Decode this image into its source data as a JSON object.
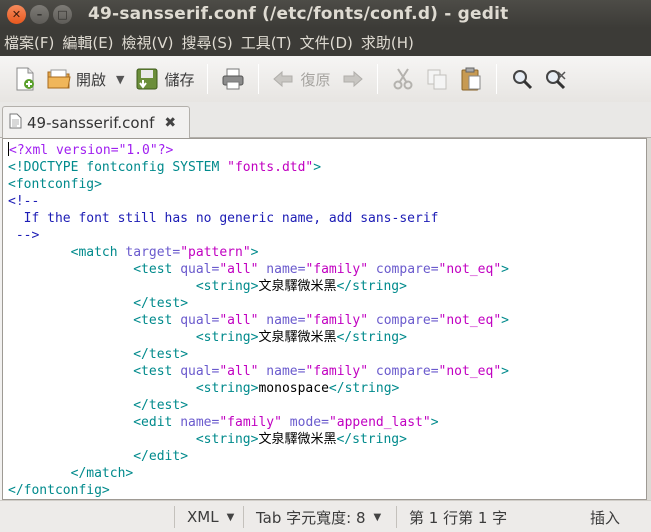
{
  "window": {
    "title": "49-sansserif.conf (/etc/fonts/conf.d) - gedit",
    "close_glyph": "✕",
    "min_glyph": "–",
    "max_glyph": "□"
  },
  "menu": [
    "檔案(F)",
    "編輯(E)",
    "檢視(V)",
    "搜尋(S)",
    "工具(T)",
    "文件(D)",
    "求助(H)"
  ],
  "toolbar": {
    "open_label": "開啟",
    "save_label": "儲存",
    "undo_label": "復原",
    "dropdown_glyph": "▼"
  },
  "tab": {
    "label": "49-sansserif.conf",
    "close_glyph": "✖"
  },
  "editor": {
    "lines": [
      [
        {
          "c": "pi",
          "t": "<?xml version=\"1.0\"?>"
        }
      ],
      [
        {
          "c": "tag",
          "t": "<!DOCTYPE fontconfig SYSTEM "
        },
        {
          "c": "str",
          "t": "\"fonts.dtd\""
        },
        {
          "c": "tag",
          "t": ">"
        }
      ],
      [
        {
          "c": "tag",
          "t": "<fontconfig>"
        }
      ],
      [
        {
          "c": "cmt",
          "t": "<!--"
        }
      ],
      [
        {
          "c": "cmt",
          "t": "  If the font still has no generic name, add sans-serif"
        }
      ],
      [
        {
          "c": "cmt",
          "t": " -->"
        }
      ],
      [
        {
          "c": "txt",
          "t": "        "
        },
        {
          "c": "tag",
          "t": "<match "
        },
        {
          "c": "attr",
          "t": "target="
        },
        {
          "c": "str",
          "t": "\"pattern\""
        },
        {
          "c": "tag",
          "t": ">"
        }
      ],
      [
        {
          "c": "txt",
          "t": "                "
        },
        {
          "c": "tag",
          "t": "<test "
        },
        {
          "c": "attr",
          "t": "qual="
        },
        {
          "c": "str",
          "t": "\"all\""
        },
        {
          "c": "attr",
          "t": " name="
        },
        {
          "c": "str",
          "t": "\"family\""
        },
        {
          "c": "attr",
          "t": " compare="
        },
        {
          "c": "str",
          "t": "\"not_eq\""
        },
        {
          "c": "tag",
          "t": ">"
        }
      ],
      [
        {
          "c": "txt",
          "t": "                        "
        },
        {
          "c": "tag",
          "t": "<string>"
        },
        {
          "c": "txt",
          "t": "文泉驛微米黑"
        },
        {
          "c": "tag",
          "t": "</string>"
        }
      ],
      [
        {
          "c": "txt",
          "t": "                "
        },
        {
          "c": "tag",
          "t": "</test>"
        }
      ],
      [
        {
          "c": "txt",
          "t": "                "
        },
        {
          "c": "tag",
          "t": "<test "
        },
        {
          "c": "attr",
          "t": "qual="
        },
        {
          "c": "str",
          "t": "\"all\""
        },
        {
          "c": "attr",
          "t": " name="
        },
        {
          "c": "str",
          "t": "\"family\""
        },
        {
          "c": "attr",
          "t": " compare="
        },
        {
          "c": "str",
          "t": "\"not_eq\""
        },
        {
          "c": "tag",
          "t": ">"
        }
      ],
      [
        {
          "c": "txt",
          "t": "                        "
        },
        {
          "c": "tag",
          "t": "<string>"
        },
        {
          "c": "txt",
          "t": "文泉驛微米黑"
        },
        {
          "c": "tag",
          "t": "</string>"
        }
      ],
      [
        {
          "c": "txt",
          "t": "                "
        },
        {
          "c": "tag",
          "t": "</test>"
        }
      ],
      [
        {
          "c": "txt",
          "t": "                "
        },
        {
          "c": "tag",
          "t": "<test "
        },
        {
          "c": "attr",
          "t": "qual="
        },
        {
          "c": "str",
          "t": "\"all\""
        },
        {
          "c": "attr",
          "t": " name="
        },
        {
          "c": "str",
          "t": "\"family\""
        },
        {
          "c": "attr",
          "t": " compare="
        },
        {
          "c": "str",
          "t": "\"not_eq\""
        },
        {
          "c": "tag",
          "t": ">"
        }
      ],
      [
        {
          "c": "txt",
          "t": "                        "
        },
        {
          "c": "tag",
          "t": "<string>"
        },
        {
          "c": "txt",
          "t": "monospace"
        },
        {
          "c": "tag",
          "t": "</string>"
        }
      ],
      [
        {
          "c": "txt",
          "t": "                "
        },
        {
          "c": "tag",
          "t": "</test>"
        }
      ],
      [
        {
          "c": "txt",
          "t": "                "
        },
        {
          "c": "tag",
          "t": "<edit "
        },
        {
          "c": "attr",
          "t": "name="
        },
        {
          "c": "str",
          "t": "\"family\""
        },
        {
          "c": "attr",
          "t": " mode="
        },
        {
          "c": "str",
          "t": "\"append_last\""
        },
        {
          "c": "tag",
          "t": ">"
        }
      ],
      [
        {
          "c": "txt",
          "t": "                        "
        },
        {
          "c": "tag",
          "t": "<string>"
        },
        {
          "c": "txt",
          "t": "文泉驛微米黑"
        },
        {
          "c": "tag",
          "t": "</string>"
        }
      ],
      [
        {
          "c": "txt",
          "t": "                "
        },
        {
          "c": "tag",
          "t": "</edit>"
        }
      ],
      [
        {
          "c": "txt",
          "t": "        "
        },
        {
          "c": "tag",
          "t": "</match>"
        }
      ],
      [
        {
          "c": "tag",
          "t": "</fontconfig>"
        }
      ]
    ]
  },
  "statusbar": {
    "language": "XML",
    "tab_width": "Tab 字元寬度: 8",
    "position": "第 1 行第 1 字",
    "mode": "插入",
    "caret_glyph": "▼"
  },
  "colors": {
    "titlebar": "#3c3b37",
    "close_button": "#e8581e",
    "tag": "#008a8c",
    "attribute": "#6a5acd",
    "string": "#c100c1",
    "comment": "#1c1cb5"
  },
  "icons": [
    "new-document-icon",
    "open-folder-icon",
    "save-icon",
    "print-icon",
    "undo-icon",
    "redo-icon",
    "cut-icon",
    "copy-icon",
    "paste-icon",
    "find-icon",
    "find-replace-icon",
    "document-icon"
  ]
}
